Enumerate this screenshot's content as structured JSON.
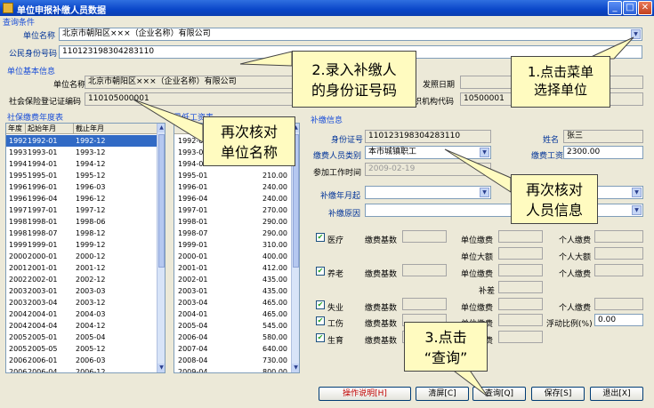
{
  "window": {
    "title": "单位申报补缴人员数据"
  },
  "query_group": {
    "title": "查询条件",
    "unit_name_label": "单位名称",
    "unit_name_value": "北京市朝阳区×××（企业名称）有限公司",
    "id_label": "公民身份号码",
    "id_value": "110123198304283110"
  },
  "basic_info": {
    "title": "单位基本信息",
    "unit_name_label": "单位名称",
    "unit_name_value": "北京市朝阳区×××（企业名称）有限公司",
    "reg_label": "社会保险登记证编码",
    "reg_value": "110105000001",
    "issue_date_label": "发照日期",
    "org_code_label": "织机构代码",
    "org_code_value": "10500001"
  },
  "year_table": {
    "title": "社保缴费年度表",
    "headers": [
      "年度",
      "起始年月",
      "截止年月"
    ],
    "rows": [
      [
        "1992",
        "1992-01",
        "1992-12"
      ],
      [
        "1993",
        "1993-01",
        "1993-12"
      ],
      [
        "1994",
        "1994-01",
        "1994-12"
      ],
      [
        "1995",
        "1995-01",
        "1995-12"
      ],
      [
        "1996",
        "1996-01",
        "1996-03"
      ],
      [
        "1996",
        "1996-04",
        "1996-12"
      ],
      [
        "1997",
        "1997-01",
        "1997-12"
      ],
      [
        "1998",
        "1998-01",
        "1998-06"
      ],
      [
        "1998",
        "1998-07",
        "1998-12"
      ],
      [
        "1999",
        "1999-01",
        "1999-12"
      ],
      [
        "2000",
        "2000-01",
        "2000-12"
      ],
      [
        "2001",
        "2001-01",
        "2001-12"
      ],
      [
        "2002",
        "2002-01",
        "2002-12"
      ],
      [
        "2003",
        "2003-01",
        "2003-03"
      ],
      [
        "2003",
        "2003-04",
        "2003-12"
      ],
      [
        "2004",
        "2004-01",
        "2004-03"
      ],
      [
        "2004",
        "2004-04",
        "2004-12"
      ],
      [
        "2005",
        "2005-01",
        "2005-04"
      ],
      [
        "2005",
        "2005-05",
        "2005-12"
      ],
      [
        "2006",
        "2006-01",
        "2006-03"
      ],
      [
        "2006",
        "2006-04",
        "2006-12"
      ]
    ]
  },
  "wage_table": {
    "title": "最低工资表",
    "rows": [
      [
        "1992-01",
        ""
      ],
      [
        "1993-01",
        ""
      ],
      [
        "1994-01",
        ""
      ],
      [
        "1995-01",
        "210.00"
      ],
      [
        "1996-01",
        "240.00"
      ],
      [
        "1996-04",
        "240.00"
      ],
      [
        "1997-01",
        "270.00"
      ],
      [
        "1998-01",
        "290.00"
      ],
      [
        "1998-07",
        "290.00"
      ],
      [
        "1999-01",
        "310.00"
      ],
      [
        "2000-01",
        "400.00"
      ],
      [
        "2001-01",
        "412.00"
      ],
      [
        "2002-01",
        "435.00"
      ],
      [
        "2003-01",
        "435.00"
      ],
      [
        "2003-04",
        "465.00"
      ],
      [
        "2004-01",
        "465.00"
      ],
      [
        "2005-04",
        "545.00"
      ],
      [
        "2006-04",
        "580.00"
      ],
      [
        "2007-04",
        "640.00"
      ],
      [
        "2008-04",
        "730.00"
      ],
      [
        "2009-04",
        "800.00"
      ]
    ]
  },
  "person": {
    "title": "补缴信息",
    "id_label": "身份证号",
    "id_value": "110123198304283110",
    "name_label": "姓名",
    "name_value": "张三",
    "category_label": "缴费人员类别",
    "category_value": "本市城镇职工",
    "wage_label": "缴费工资",
    "wage_value": "2300.00",
    "work_date_label": "参加工作时间",
    "work_date_value": "2009-02-19",
    "start_label": "补缴年月起",
    "reason_label": "补缴原因"
  },
  "insurance": {
    "medical": "医疗",
    "pension": "养老",
    "unemployment": "失业",
    "injury": "工伤",
    "maternity": "生育",
    "base": "缴费基数",
    "unit_pay": "单位缴费",
    "personal_pay": "个人缴费",
    "unit_large": "单位大额",
    "personal_large": "个人大额",
    "subsidy": "补差",
    "float_ratio": "浮动比例(%)",
    "float_value": "0.00"
  },
  "buttons": {
    "help": "操作说明[H]",
    "clear": "清屏[C]",
    "query": "查询[Q]",
    "save": "保存[S]",
    "exit": "退出[X]"
  },
  "callouts": {
    "c1_line1": "1.点击菜单",
    "c1_line2": "选择单位",
    "c2_line1": "2.录入补缴人",
    "c2_line2": "的身份证号码",
    "c3_line1": "再次核对",
    "c3_line2": "单位名称",
    "c4_line1": "再次核对",
    "c4_line2": "人员信息",
    "c5_line1": "3.点击",
    "c5_line2": "“查询”"
  }
}
